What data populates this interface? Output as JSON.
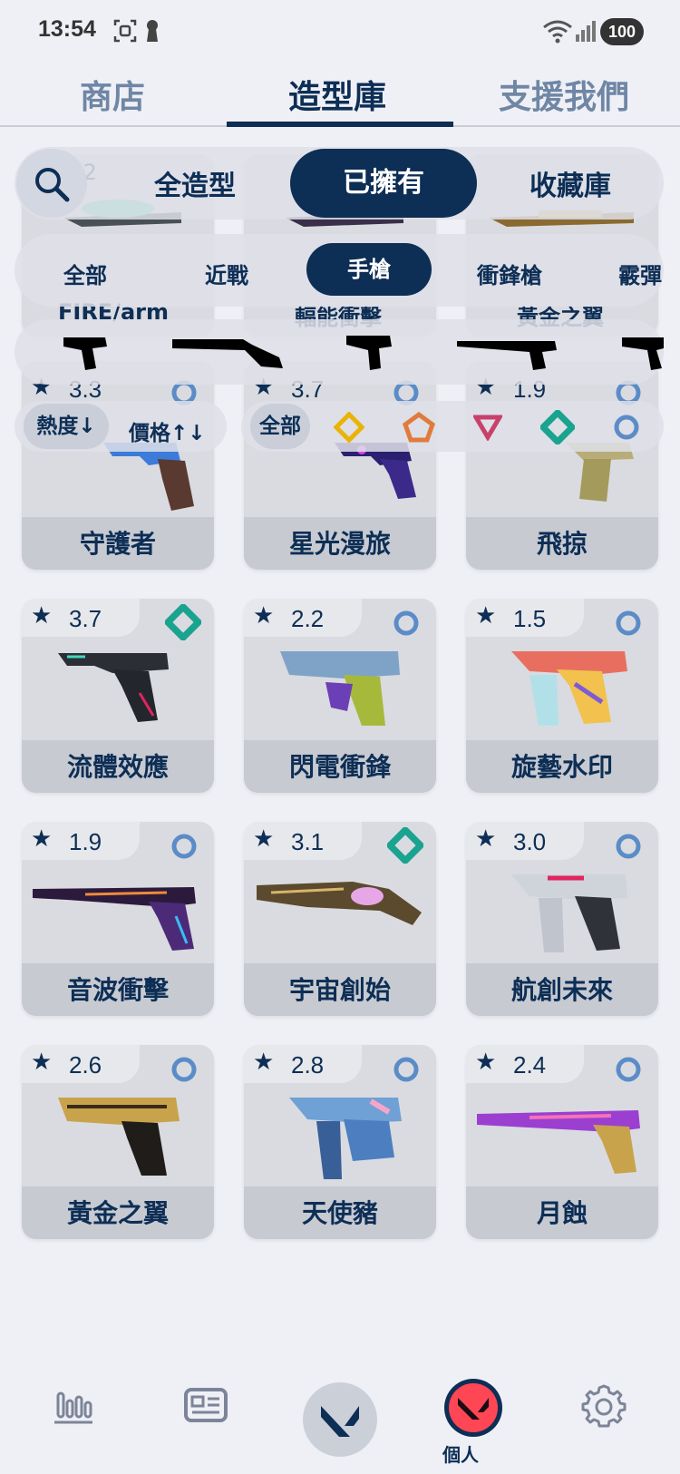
{
  "status": {
    "time": "13:54",
    "battery": "100"
  },
  "top_tabs": [
    {
      "label": "商店"
    },
    {
      "label": "造型庫"
    },
    {
      "label": "支援我們"
    }
  ],
  "filter": {
    "scope": [
      "全造型",
      "已擁有",
      "收藏庫"
    ],
    "scope_selected": "已擁有",
    "categories": [
      "全部",
      "近戰",
      "手槍",
      "衝鋒槍",
      "霰彈"
    ],
    "category_selected": "手槍",
    "weapon_icons": [
      "classic-pistol-icon",
      "shorty-shotgun-icon",
      "frenzy-pistol-icon",
      "ghost-pistol-icon",
      "sheriff-pistol-icon"
    ],
    "sort": [
      "熱度↓",
      "價格↑↓"
    ],
    "tiers": [
      "全部",
      "exclusive-tier-icon",
      "ultra-tier-icon",
      "premium-tier-icon",
      "deluxe-tier-icon",
      "select-tier-icon"
    ],
    "tier_selected": "全部"
  },
  "partial_row": {
    "first_rating": ".2",
    "names": [
      "FIRE/arm",
      "輻能衝擊",
      "黃金之翼"
    ]
  },
  "cards": [
    {
      "name": "守護者",
      "rating": "3.3",
      "tier": "select"
    },
    {
      "name": "星光漫旅",
      "rating": "3.7",
      "tier": "select"
    },
    {
      "name": "飛掠",
      "rating": "1.9",
      "tier": "select"
    },
    {
      "name": "流體效應",
      "rating": "3.7",
      "tier": "deluxe"
    },
    {
      "name": "閃電衝鋒",
      "rating": "2.2",
      "tier": "select"
    },
    {
      "name": "旋藝水印",
      "rating": "1.5",
      "tier": "select"
    },
    {
      "name": "音波衝擊",
      "rating": "1.9",
      "tier": "select"
    },
    {
      "name": "宇宙創始",
      "rating": "3.1",
      "tier": "deluxe"
    },
    {
      "name": "航創未來",
      "rating": "3.0",
      "tier": "select"
    },
    {
      "name": "黃金之翼",
      "rating": "2.6",
      "tier": "select"
    },
    {
      "name": "天使豬",
      "rating": "2.8",
      "tier": "select"
    },
    {
      "name": "月蝕",
      "rating": "2.4",
      "tier": "select"
    }
  ],
  "colors": {
    "navy": "#0d2e55",
    "select": "#5b8cc7",
    "deluxe": "#1aa38f",
    "premium": "#c8416b",
    "ultra": "#e17b3c",
    "exclusive": "#eab308"
  },
  "bottom_nav": {
    "items": [
      "stats-icon",
      "news-icon",
      "valorant-logo-icon",
      "profile-avatar-icon",
      "settings-gear-icon"
    ],
    "profile_label": "個人"
  }
}
